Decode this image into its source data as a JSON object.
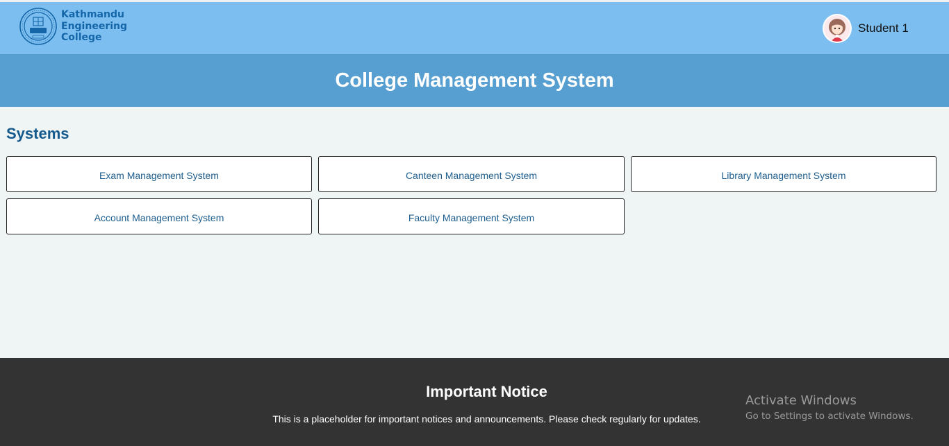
{
  "header": {
    "logo_lines": [
      "Kathmandu",
      "Engineering",
      "College"
    ],
    "user_name": "Student 1"
  },
  "banner": {
    "title": "College Management System"
  },
  "systems": {
    "heading": "Systems",
    "items": [
      {
        "label": "Exam Management System"
      },
      {
        "label": "Canteen Management System"
      },
      {
        "label": "Library Management System"
      },
      {
        "label": "Account Management System"
      },
      {
        "label": "Faculty Management System"
      }
    ]
  },
  "footer": {
    "notice_title": "Important Notice",
    "notice_text": "This is a placeholder for important notices and announcements. Please check regularly for updates."
  },
  "watermark": {
    "title": "Activate Windows",
    "subtitle": "Go to Settings to activate Windows."
  },
  "colors": {
    "header_bg": "#7dbef0",
    "banner_bg": "#589fd1",
    "accent_text": "#155a8d",
    "footer_bg": "#333333"
  }
}
